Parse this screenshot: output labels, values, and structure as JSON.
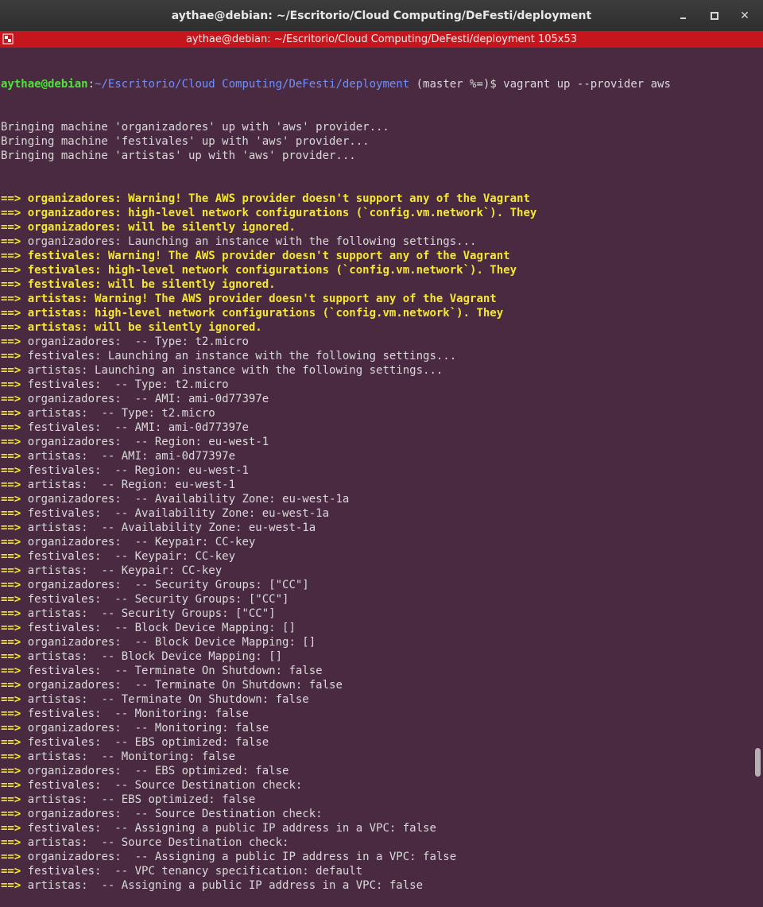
{
  "window": {
    "title": "aythae@debian: ~/Escritorio/Cloud Computing/DeFesti/deployment",
    "tab_title": "aythae@debian: ~/Escritorio/Cloud Computing/DeFesti/deployment 105x53"
  },
  "prompt": {
    "user_host": "aythae@debian",
    "sep": ":",
    "path": "~/Escritorio/Cloud Computing/DeFesti/deployment",
    "rest": " (master %=)$ vagrant up --provider aws"
  },
  "plain_lines": [
    "Bringing machine 'organizadores' up with 'aws' provider...",
    "Bringing machine 'festivales' up with 'aws' provider...",
    "Bringing machine 'artistas' up with 'aws' provider..."
  ],
  "arrow": "==>",
  "output_lines": [
    {
      "text": " organizadores: Warning! The AWS provider doesn't support any of the Vagrant",
      "warn": true
    },
    {
      "text": " organizadores: high-level network configurations (`config.vm.network`). They",
      "warn": true
    },
    {
      "text": " organizadores: will be silently ignored.",
      "warn": true
    },
    {
      "text": " organizadores: Launching an instance with the following settings...",
      "warn": false
    },
    {
      "text": " festivales: Warning! The AWS provider doesn't support any of the Vagrant",
      "warn": true
    },
    {
      "text": " festivales: high-level network configurations (`config.vm.network`). They",
      "warn": true
    },
    {
      "text": " festivales: will be silently ignored.",
      "warn": true
    },
    {
      "text": " artistas: Warning! The AWS provider doesn't support any of the Vagrant",
      "warn": true
    },
    {
      "text": " artistas: high-level network configurations (`config.vm.network`). They",
      "warn": true
    },
    {
      "text": " artistas: will be silently ignored.",
      "warn": true
    },
    {
      "text": " organizadores:  -- Type: t2.micro",
      "warn": false
    },
    {
      "text": " festivales: Launching an instance with the following settings...",
      "warn": false
    },
    {
      "text": " artistas: Launching an instance with the following settings...",
      "warn": false
    },
    {
      "text": " festivales:  -- Type: t2.micro",
      "warn": false
    },
    {
      "text": " organizadores:  -- AMI: ami-0d77397e",
      "warn": false
    },
    {
      "text": " artistas:  -- Type: t2.micro",
      "warn": false
    },
    {
      "text": " festivales:  -- AMI: ami-0d77397e",
      "warn": false
    },
    {
      "text": " organizadores:  -- Region: eu-west-1",
      "warn": false
    },
    {
      "text": " artistas:  -- AMI: ami-0d77397e",
      "warn": false
    },
    {
      "text": " festivales:  -- Region: eu-west-1",
      "warn": false
    },
    {
      "text": " artistas:  -- Region: eu-west-1",
      "warn": false
    },
    {
      "text": " organizadores:  -- Availability Zone: eu-west-1a",
      "warn": false
    },
    {
      "text": " festivales:  -- Availability Zone: eu-west-1a",
      "warn": false
    },
    {
      "text": " artistas:  -- Availability Zone: eu-west-1a",
      "warn": false
    },
    {
      "text": " organizadores:  -- Keypair: CC-key",
      "warn": false
    },
    {
      "text": " festivales:  -- Keypair: CC-key",
      "warn": false
    },
    {
      "text": " artistas:  -- Keypair: CC-key",
      "warn": false
    },
    {
      "text": " organizadores:  -- Security Groups: [\"CC\"]",
      "warn": false
    },
    {
      "text": " festivales:  -- Security Groups: [\"CC\"]",
      "warn": false
    },
    {
      "text": " artistas:  -- Security Groups: [\"CC\"]",
      "warn": false
    },
    {
      "text": " festivales:  -- Block Device Mapping: []",
      "warn": false
    },
    {
      "text": " organizadores:  -- Block Device Mapping: []",
      "warn": false
    },
    {
      "text": " artistas:  -- Block Device Mapping: []",
      "warn": false
    },
    {
      "text": " festivales:  -- Terminate On Shutdown: false",
      "warn": false
    },
    {
      "text": " organizadores:  -- Terminate On Shutdown: false",
      "warn": false
    },
    {
      "text": " artistas:  -- Terminate On Shutdown: false",
      "warn": false
    },
    {
      "text": " festivales:  -- Monitoring: false",
      "warn": false
    },
    {
      "text": " organizadores:  -- Monitoring: false",
      "warn": false
    },
    {
      "text": " festivales:  -- EBS optimized: false",
      "warn": false
    },
    {
      "text": " artistas:  -- Monitoring: false",
      "warn": false
    },
    {
      "text": " organizadores:  -- EBS optimized: false",
      "warn": false
    },
    {
      "text": " festivales:  -- Source Destination check:",
      "warn": false
    },
    {
      "text": " artistas:  -- EBS optimized: false",
      "warn": false
    },
    {
      "text": " organizadores:  -- Source Destination check:",
      "warn": false
    },
    {
      "text": " festivales:  -- Assigning a public IP address in a VPC: false",
      "warn": false
    },
    {
      "text": " artistas:  -- Source Destination check:",
      "warn": false
    },
    {
      "text": " organizadores:  -- Assigning a public IP address in a VPC: false",
      "warn": false
    },
    {
      "text": " festivales:  -- VPC tenancy specification: default",
      "warn": false
    },
    {
      "text": " artistas:  -- Assigning a public IP address in a VPC: false",
      "warn": false
    }
  ],
  "colors": {
    "background": "#4a2a41",
    "tab_bar": "#c4161c",
    "warning": "#f5e633",
    "prompt_user": "#4ce43a",
    "prompt_path": "#6f8fff"
  },
  "icons": {
    "tab": "terminal-tab-icon",
    "minimize": "minimize-icon",
    "maximize": "maximize-icon",
    "close": "close-icon"
  }
}
